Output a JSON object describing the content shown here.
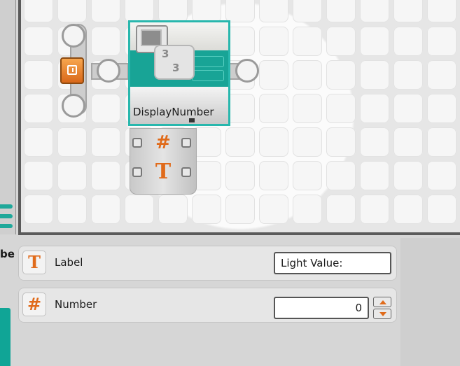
{
  "canvas": {
    "block": {
      "label": "DisplayNumber",
      "icon": "display-number-icon",
      "accent": "#18a496",
      "selection_color": "#28b7ad",
      "number_digit_top": "3",
      "number_digit_bottom": "3"
    },
    "hub_plugs": [
      {
        "icon": "hash-icon",
        "glyph": "#"
      },
      {
        "icon": "text-icon",
        "glyph": "T"
      }
    ]
  },
  "properties": {
    "side_label": "be",
    "label_row": {
      "icon": "text-icon",
      "glyph": "T",
      "label": "Label",
      "value": "Light Value:"
    },
    "number_row": {
      "icon": "hash-icon",
      "glyph": "#",
      "label": "Number",
      "value": "0"
    }
  }
}
